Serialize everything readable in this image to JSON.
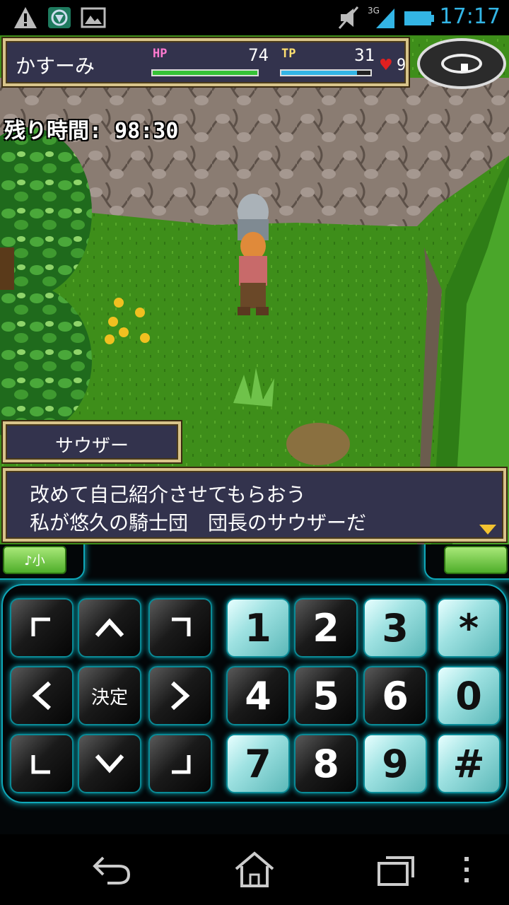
{
  "status_bar": {
    "time": "17:17",
    "network": "3G",
    "icons": [
      "warning-icon",
      "shield-app-icon",
      "image-icon",
      "mute-icon",
      "signal-icon",
      "battery-icon"
    ]
  },
  "hud": {
    "player_name": "かすーみ",
    "hp_label": "HP",
    "hp_value": "74",
    "hp_fill": 1.0,
    "tp_label": "TP",
    "tp_value": "31",
    "tp_fill": 0.85,
    "heart_count": "9",
    "colors": {
      "hp": "#36c236",
      "tp": "#33b5e5",
      "frame": "#d8c48a",
      "panel": "#33334d"
    }
  },
  "timer": {
    "text": "残り時間: 98:30"
  },
  "dialog": {
    "speaker": "サウザー",
    "lines": [
      "改めて自己紹介させてもらおう",
      "私が悠久の騎士団　団長のサウザーだ"
    ]
  },
  "controller": {
    "volume_label": "♪小",
    "ok_label": "決定",
    "numpad": [
      "1",
      "2",
      "3",
      "*",
      "4",
      "5",
      "6",
      "0",
      "7",
      "8",
      "9",
      "#"
    ],
    "accent": "#0fa7b8"
  },
  "navbar": {
    "icons": [
      "back-icon",
      "home-icon",
      "recent-apps-icon",
      "menu-icon"
    ]
  }
}
